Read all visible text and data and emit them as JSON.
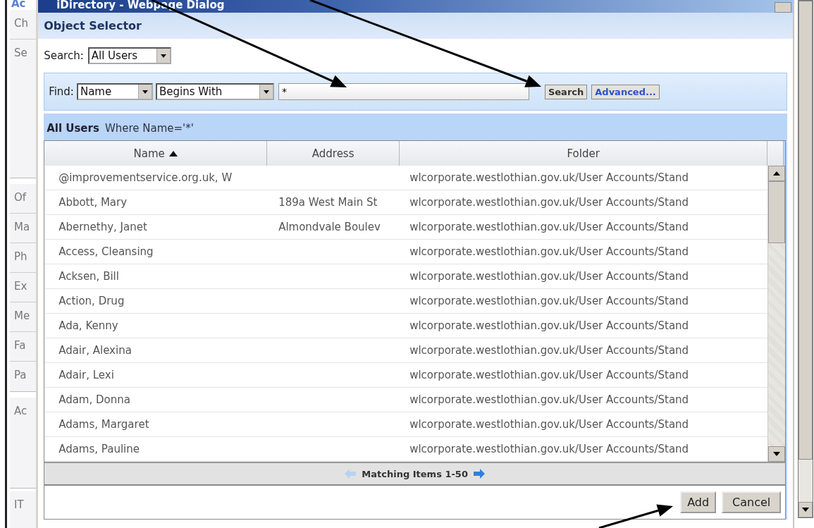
{
  "background_page": {
    "tab_label": "Ac",
    "groups": [
      [
        "Ch",
        "Se"
      ],
      [
        "Of",
        "Ma",
        "Ph",
        "Ex",
        "Me",
        "Fa",
        "Pa"
      ],
      [
        "Ac"
      ],
      [
        "IT"
      ]
    ]
  },
  "window": {
    "title": "iDirectory - Webpage Dialog"
  },
  "dialog": {
    "title": "Object Selector",
    "search": {
      "label": "Search:",
      "value": "All Users"
    },
    "find": {
      "label": "Find:",
      "field": "Name",
      "operator": "Begins With",
      "value": "*",
      "buttons": [
        {
          "label": "Search",
          "kind": "plain"
        },
        {
          "label": "Advanced...",
          "kind": "link"
        }
      ]
    },
    "result_heading": {
      "scope": "All Users",
      "condition": "Where Name='*'"
    },
    "table": {
      "columns": [
        {
          "label": "Name",
          "sorted": true
        },
        {
          "label": "Address",
          "sorted": false
        },
        {
          "label": "Folder",
          "sorted": false
        }
      ],
      "rows": [
        [
          "@improvementservice.org.uk, W",
          "",
          "wlcorporate.westlothian.gov.uk/User Accounts/Stand"
        ],
        [
          "Abbott, Mary",
          "189a West Main St",
          "wlcorporate.westlothian.gov.uk/User Accounts/Stand"
        ],
        [
          "Abernethy, Janet",
          "Almondvale Boulev",
          "wlcorporate.westlothian.gov.uk/User Accounts/Stand"
        ],
        [
          "Access, Cleansing",
          "",
          "wlcorporate.westlothian.gov.uk/User Accounts/Stand"
        ],
        [
          "Acksen, Bill",
          "",
          "wlcorporate.westlothian.gov.uk/User Accounts/Stand"
        ],
        [
          "Action, Drug",
          "",
          "wlcorporate.westlothian.gov.uk/User Accounts/Stand"
        ],
        [
          "Ada, Kenny",
          "",
          "wlcorporate.westlothian.gov.uk/User Accounts/Stand"
        ],
        [
          "Adair, Alexina",
          "",
          "wlcorporate.westlothian.gov.uk/User Accounts/Stand"
        ],
        [
          "Adair, Lexi",
          "",
          "wlcorporate.westlothian.gov.uk/User Accounts/Stand"
        ],
        [
          "Adam, Donna",
          "",
          "wlcorporate.westlothian.gov.uk/User Accounts/Stand"
        ],
        [
          "Adams, Margaret",
          "",
          "wlcorporate.westlothian.gov.uk/User Accounts/Stand"
        ],
        [
          "Adams, Pauline",
          "",
          "wlcorporate.westlothian.gov.uk/User Accounts/Stand"
        ]
      ]
    },
    "pager": {
      "label": "Matching Items 1-50",
      "previous_disabled": true,
      "next_disabled": false
    },
    "buttons": [
      "Add",
      "Cancel"
    ]
  }
}
